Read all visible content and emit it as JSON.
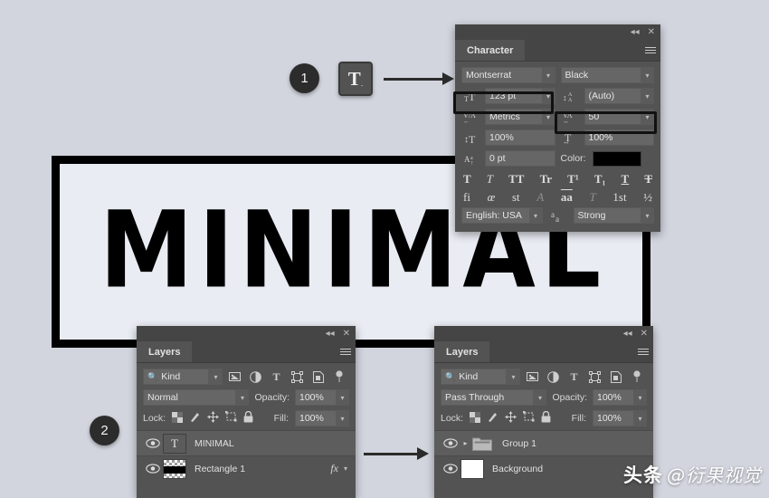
{
  "canvas": {
    "artwork_text": "MINIMAL"
  },
  "markers": [
    {
      "label": "1"
    },
    {
      "label": "2"
    }
  ],
  "tool_badge": {
    "letter": "T",
    "sub": "."
  },
  "character_panel": {
    "tab": "Character",
    "collapse_icon": "collapse-icon",
    "close_icon": "close-icon",
    "menu_icon": "panel-menu-icon",
    "font_family": "Montserrat",
    "font_style": "Black",
    "font_size_label": "font-size-icon",
    "font_size": "123 pt",
    "leading_label": "leading-icon",
    "leading": "(Auto)",
    "kerning_label": "kerning-icon",
    "kerning": "Metrics",
    "tracking_label": "tracking-icon",
    "tracking": "50",
    "vertical_scale_label": "vertical-scale-icon",
    "vertical_scale": "100%",
    "horizontal_scale_label": "horizontal-scale-icon",
    "horizontal_scale": "100%",
    "baseline_label": "baseline-shift-icon",
    "baseline_shift": "0 pt",
    "color_label": "Color:",
    "color_value": "#000000",
    "style_row_1": [
      "T",
      "T",
      "TT",
      "Tr",
      "T¹",
      "T₁",
      "T",
      "T"
    ],
    "style_row_2": [
      "fi",
      "œ",
      "st",
      "A",
      "aa",
      "T",
      "1st",
      "½"
    ],
    "language": "English: USA",
    "antialias_icon": "anti-alias-icon",
    "antialias": "Strong"
  },
  "layers_panel_left": {
    "tab": "Layers",
    "collapse_icon": "collapse-icon",
    "close_icon": "close-icon",
    "menu_icon": "panel-menu-icon",
    "filter_label": "Kind",
    "filter_icons": [
      "pixel-filter-icon",
      "adjustment-filter-icon",
      "type-filter-icon",
      "shape-filter-icon",
      "smart-object-filter-icon"
    ],
    "blend_mode": "Normal",
    "opacity_label": "Opacity:",
    "opacity": "100%",
    "lock_label": "Lock:",
    "lock_icons": [
      "lock-transparent-icon",
      "lock-image-icon",
      "lock-position-icon",
      "lock-artboard-icon",
      "lock-all-icon"
    ],
    "fill_label": "Fill:",
    "fill": "100%",
    "layers": [
      {
        "name": "MINIMAL",
        "thumb": "type-thumb",
        "selected": true,
        "fx": ""
      },
      {
        "name": "Rectangle 1",
        "thumb": "shape-thumb",
        "selected": false,
        "fx": "fx"
      }
    ]
  },
  "layers_panel_right": {
    "tab": "Layers",
    "collapse_icon": "collapse-icon",
    "close_icon": "close-icon",
    "menu_icon": "panel-menu-icon",
    "filter_label": "Kind",
    "blend_mode": "Pass Through",
    "opacity_label": "Opacity:",
    "opacity": "100%",
    "lock_label": "Lock:",
    "fill_label": "Fill:",
    "fill": "100%",
    "layers": [
      {
        "name": "Group 1",
        "thumb": "folder-thumb",
        "selected": true
      },
      {
        "name": "Background",
        "thumb": "white-thumb",
        "selected": false
      }
    ]
  },
  "watermark": {
    "brand": "头条",
    "handle": "@衍果视觉"
  }
}
